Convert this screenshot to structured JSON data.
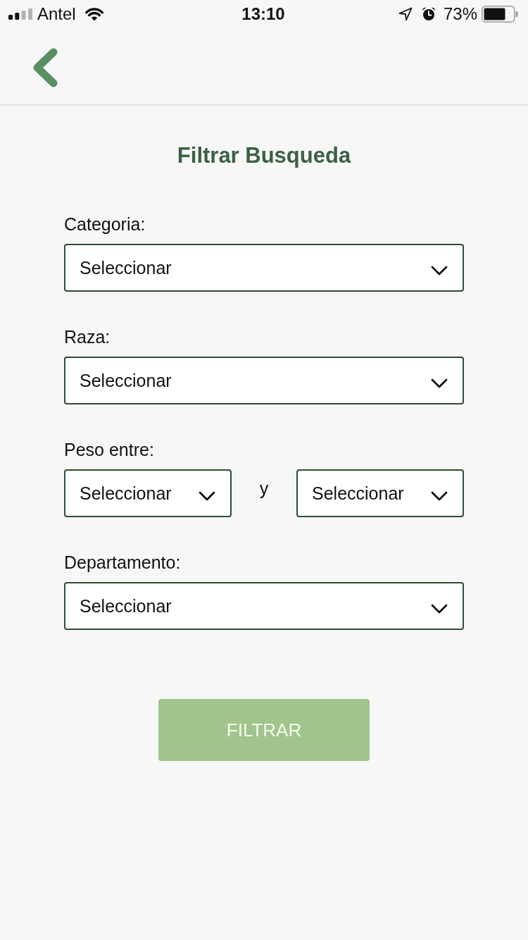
{
  "status_bar": {
    "carrier": "Antel",
    "time": "13:10",
    "battery": "73%"
  },
  "title": "Filtrar Busqueda",
  "fields": [
    {
      "kind": "single",
      "label": "Categoria:",
      "selects": [
        {
          "placeholder": "Seleccionar"
        }
      ]
    },
    {
      "kind": "single",
      "label": "Raza:",
      "selects": [
        {
          "placeholder": "Seleccionar"
        }
      ]
    },
    {
      "kind": "range",
      "label": "Peso entre:",
      "selects": [
        {
          "placeholder": "Seleccionar"
        },
        {
          "placeholder": "Seleccionar"
        }
      ],
      "separator": "y"
    },
    {
      "kind": "single",
      "label": "Departamento:",
      "selects": [
        {
          "placeholder": "Seleccionar"
        }
      ]
    }
  ],
  "button": "FILTRAR"
}
